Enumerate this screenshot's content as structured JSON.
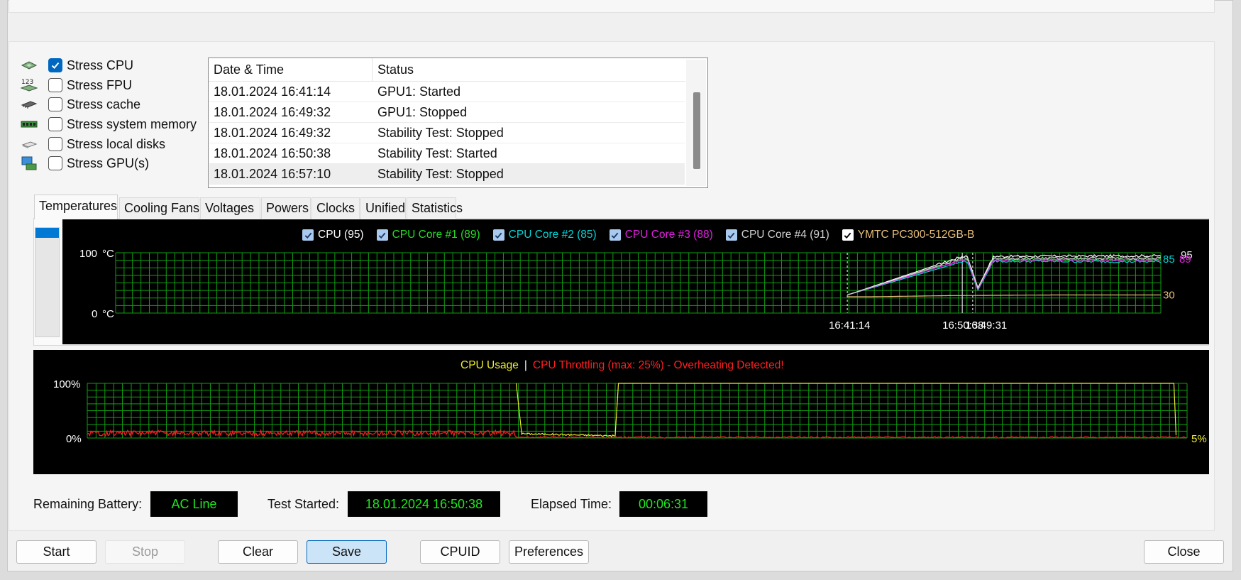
{
  "stress_options": [
    {
      "label": "Stress CPU",
      "checked": true,
      "icon": "cpu-chip-icon"
    },
    {
      "label": "Stress FPU",
      "checked": false,
      "icon": "fpu-123-icon"
    },
    {
      "label": "Stress cache",
      "checked": false,
      "icon": "cache-chip-icon"
    },
    {
      "label": "Stress system memory",
      "checked": false,
      "icon": "memory-module-icon"
    },
    {
      "label": "Stress local disks",
      "checked": false,
      "icon": "disk-drive-icon"
    },
    {
      "label": "Stress GPU(s)",
      "checked": false,
      "icon": "gpu-monitor-icon"
    }
  ],
  "log": {
    "headers": [
      "Date & Time",
      "Status"
    ],
    "rows": [
      {
        "time": "18.01.2024 16:41:14",
        "status": "GPU1: Started"
      },
      {
        "time": "18.01.2024 16:49:32",
        "status": "GPU1: Stopped"
      },
      {
        "time": "18.01.2024 16:49:32",
        "status": "Stability Test: Stopped"
      },
      {
        "time": "18.01.2024 16:50:38",
        "status": "Stability Test: Started"
      },
      {
        "time": "18.01.2024 16:57:10",
        "status": "Stability Test: Stopped"
      }
    ],
    "selected_row": 4
  },
  "tabs": [
    "Temperatures",
    "Cooling Fans",
    "Voltages",
    "Powers",
    "Clocks",
    "Unified",
    "Statistics"
  ],
  "active_tab": "Temperatures",
  "chart_data": [
    {
      "type": "line",
      "title": "",
      "ylabel": "°C",
      "ylim": [
        0,
        100
      ],
      "y_tick_labels": [
        "100",
        "0"
      ],
      "y_unit": "°C",
      "x_tick_labels": [
        "16:41:14",
        "16:50:38",
        "16:49:31"
      ],
      "grid": true,
      "legend_placement": "top",
      "series": [
        {
          "name": "CPU (95)",
          "color": "#ffffff",
          "checked": true,
          "current": 95,
          "x": [
            0.7,
            0.81,
            0.815,
            0.825,
            0.84,
            1.0
          ],
          "values": [
            30,
            94,
            94,
            42,
            94,
            95
          ]
        },
        {
          "name": "CPU Core #1 (89)",
          "color": "#22dd22",
          "checked": true,
          "current": 89,
          "x": [
            0.7,
            0.81,
            0.815,
            0.825,
            0.84,
            1.0
          ],
          "values": [
            30,
            89,
            89,
            40,
            89,
            89
          ]
        },
        {
          "name": "CPU Core #2 (85)",
          "color": "#00d6d6",
          "checked": true,
          "current": 85,
          "x": [
            0.7,
            0.81,
            0.815,
            0.825,
            0.84,
            1.0
          ],
          "values": [
            30,
            85,
            85,
            38,
            86,
            85
          ]
        },
        {
          "name": "CPU Core #3 (88)",
          "color": "#e020e0",
          "checked": true,
          "current": 88,
          "x": [
            0.7,
            0.81,
            0.815,
            0.825,
            0.84,
            1.0
          ],
          "values": [
            30,
            88,
            88,
            39,
            88,
            88
          ]
        },
        {
          "name": "CPU Core #4 (91)",
          "color": "#cfcfcf",
          "checked": true,
          "current": 91,
          "x": [
            0.7,
            0.81,
            0.815,
            0.825,
            0.84,
            1.0
          ],
          "values": [
            30,
            91,
            91,
            41,
            91,
            91
          ]
        },
        {
          "name": "YMTC PC300-512GB-B",
          "color": "#e8c07a",
          "checked": true,
          "current": 30,
          "x": [
            0.7,
            0.72,
            0.8,
            0.9,
            1.0
          ],
          "values": [
            27,
            27,
            29,
            30,
            30
          ]
        }
      ],
      "right_labels": [
        {
          "text": "95",
          "color": "#e8e8e8",
          "value": 95
        },
        {
          "text": "85",
          "color": "#00d6d6",
          "value": 85
        },
        {
          "text": "89",
          "color": "#e020e0",
          "value": 89
        },
        {
          "text": "30",
          "color": "#e8c07a",
          "value": 30
        }
      ],
      "markers_x": [
        0.7,
        0.81,
        0.82
      ]
    },
    {
      "type": "line",
      "title": "",
      "ylim": [
        0,
        100
      ],
      "y_tick_labels": [
        "100%",
        "0%"
      ],
      "grid": true,
      "legend_placement": "top",
      "legend": [
        {
          "text": "CPU Usage",
          "color": "#f0f030"
        },
        {
          "text": "|",
          "color": "#ffffff"
        },
        {
          "text": "CPU Throttling (max: 25%) - Overheating Detected!",
          "color": "#ff2020"
        }
      ],
      "series": [
        {
          "name": "CPU Usage",
          "color": "#f0f030",
          "x": [
            0.39,
            0.395,
            0.48,
            0.483,
            0.988,
            0.99
          ],
          "values": [
            100,
            8,
            4,
            100,
            100,
            5
          ]
        },
        {
          "name": "CPU Throttling",
          "color": "#ff2020",
          "max": 25,
          "x": [
            0,
            0.39,
            0.4,
            1.0
          ],
          "values": [
            10,
            10,
            2,
            1
          ]
        }
      ],
      "right_labels": [
        {
          "text": "5%",
          "color": "#f0f030"
        },
        {
          "text": "0%",
          "color": "#ff2020"
        }
      ]
    }
  ],
  "status": {
    "battery_label": "Remaining Battery:",
    "battery_value": "AC Line",
    "started_label": "Test Started:",
    "started_value": "18.01.2024 16:50:38",
    "elapsed_label": "Elapsed Time:",
    "elapsed_value": "00:06:31"
  },
  "buttons": {
    "start": "Start",
    "stop": "Stop",
    "clear": "Clear",
    "save": "Save",
    "cpuid": "CPUID",
    "preferences": "Preferences",
    "close": "Close"
  },
  "colors": {
    "grid": "#11a011",
    "chart_bg": "#000000",
    "value_text": "#1eea1e",
    "accent": "#0067c0"
  }
}
